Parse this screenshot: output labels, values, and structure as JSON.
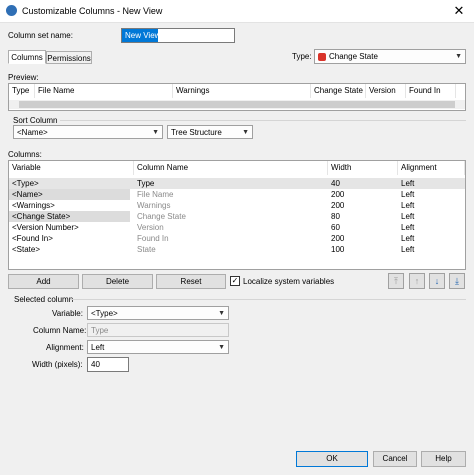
{
  "window": {
    "title": "Customizable Columns - New View",
    "close_glyph": "✕"
  },
  "form": {
    "column_set_label": "Column set name:",
    "column_set_value": "New View",
    "tabs": [
      "Columns",
      "Permissions"
    ],
    "type_label": "Type:",
    "type_value": "Change State"
  },
  "preview": {
    "label": "Preview:",
    "headers": [
      "Type",
      "File Name",
      "Warnings",
      "Change State",
      "Version",
      "Found In"
    ]
  },
  "sort": {
    "label": "Sort Column",
    "column_value": "<Name>",
    "structure_value": "Tree Structure"
  },
  "columns": {
    "label": "Columns:",
    "headers": [
      "Variable",
      "Column Name",
      "Width",
      "Alignment"
    ],
    "rows": [
      {
        "variable": "<Type>",
        "name": "Type",
        "width": "40",
        "align": "Left"
      },
      {
        "variable": "<Name>",
        "name": "File Name",
        "width": "200",
        "align": "Left"
      },
      {
        "variable": "<Warnings>",
        "name": "Warnings",
        "width": "200",
        "align": "Left"
      },
      {
        "variable": "<Change State>",
        "name": "Change State",
        "width": "80",
        "align": "Left"
      },
      {
        "variable": "<Version Number>",
        "name": "Version",
        "width": "60",
        "align": "Left"
      },
      {
        "variable": "<Found In>",
        "name": "Found In",
        "width": "200",
        "align": "Left"
      },
      {
        "variable": "<State>",
        "name": "State",
        "width": "100",
        "align": "Left"
      }
    ]
  },
  "actions": {
    "add": "Add",
    "delete": "Delete",
    "reset": "Reset",
    "localize_label": "Localize system variables",
    "localize_checked": true
  },
  "selected": {
    "label": "Selected column",
    "variable_label": "Variable:",
    "variable_value": "<Type>",
    "column_name_label": "Column Name:",
    "column_name_value": "Type",
    "alignment_label": "Alignment:",
    "alignment_value": "Left",
    "width_label": "Width (pixels):",
    "width_value": "40"
  },
  "footer": {
    "ok": "OK",
    "cancel": "Cancel",
    "help": "Help"
  },
  "colors": {
    "accent": "#0078d7",
    "selected_row": "#e5e5e5",
    "type_icon": "#d9342b"
  }
}
